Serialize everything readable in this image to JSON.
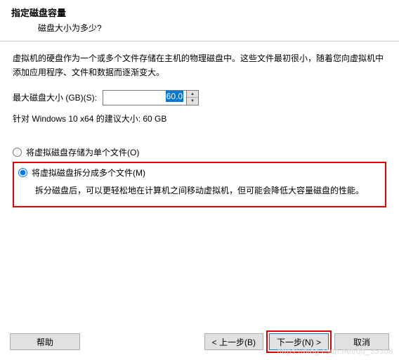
{
  "header": {
    "title": "指定磁盘容量",
    "subtitle": "磁盘大小为多少?"
  },
  "description": "虚拟机的硬盘作为一个或多个文件存储在主机的物理磁盘中。这些文件最初很小，随着您向虚拟机中添加应用程序、文件和数据而逐渐变大。",
  "disk": {
    "label": "最大磁盘大小 (GB)(S):",
    "value": "60.0",
    "recommend": "针对 Windows 10 x64 的建议大小: 60 GB"
  },
  "options": {
    "single": "将虚拟磁盘存储为单个文件(O)",
    "split": "将虚拟磁盘拆分成多个文件(M)",
    "split_desc": "拆分磁盘后，可以更轻松地在计算机之间移动虚拟机，但可能会降低大容量磁盘的性能。"
  },
  "buttons": {
    "help": "帮助",
    "back": "< 上一步(B)",
    "next": "下一步(N) >",
    "cancel": "取消"
  },
  "watermark": "https://blog.csdn.net/qq_35308"
}
